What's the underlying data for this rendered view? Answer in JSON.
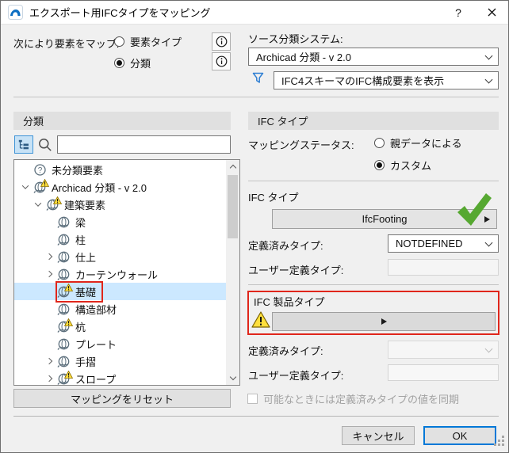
{
  "window": {
    "title": "エクスポート用IFCタイプをマッピング",
    "help_label": "?"
  },
  "header": {
    "map_by_label": "次により要素をマップ:",
    "radio_element_type": "要素タイプ",
    "radio_classification": "分類",
    "source_system_label": "ソース分類システム:",
    "source_system_value": "Archicad 分類 - v 2.0",
    "filter_value": "IFC4スキーマのIFC構成要素を表示"
  },
  "left_panel": {
    "title": "分類",
    "search_value": "",
    "tree": [
      {
        "id": "unclassified",
        "label": "未分類要素",
        "level": 0,
        "expander": "",
        "icon": "question",
        "warning": false,
        "selected": false,
        "outlined": false
      },
      {
        "id": "archicad-classification",
        "label": "Archicad 分類 - v 2.0",
        "level": 0,
        "expander": "expanded",
        "icon": "sphere",
        "warning": true,
        "selected": false,
        "outlined": false
      },
      {
        "id": "building-elements",
        "label": "建築要素",
        "level": 1,
        "expander": "expanded",
        "icon": "sphere",
        "warning": true,
        "selected": false,
        "outlined": false
      },
      {
        "id": "beam",
        "label": "梁",
        "level": 2,
        "expander": "",
        "icon": "sphere",
        "warning": false,
        "selected": false,
        "outlined": false
      },
      {
        "id": "column",
        "label": "柱",
        "level": 2,
        "expander": "",
        "icon": "sphere",
        "warning": false,
        "selected": false,
        "outlined": false
      },
      {
        "id": "finish",
        "label": "仕上",
        "level": 2,
        "expander": "collapsed",
        "icon": "sphere",
        "warning": false,
        "selected": false,
        "outlined": false
      },
      {
        "id": "curtain-wall",
        "label": "カーテンウォール",
        "level": 2,
        "expander": "collapsed",
        "icon": "sphere",
        "warning": false,
        "selected": false,
        "outlined": false
      },
      {
        "id": "foundation",
        "label": "基礎",
        "level": 2,
        "expander": "",
        "icon": "sphere",
        "warning": true,
        "selected": true,
        "outlined": true
      },
      {
        "id": "structural-member",
        "label": "構造部材",
        "level": 2,
        "expander": "",
        "icon": "sphere",
        "warning": false,
        "selected": false,
        "outlined": false
      },
      {
        "id": "pile",
        "label": "杭",
        "level": 2,
        "expander": "",
        "icon": "sphere",
        "warning": true,
        "selected": false,
        "outlined": false
      },
      {
        "id": "plate",
        "label": "プレート",
        "level": 2,
        "expander": "",
        "icon": "sphere",
        "warning": false,
        "selected": false,
        "outlined": false
      },
      {
        "id": "railing",
        "label": "手摺",
        "level": 2,
        "expander": "collapsed",
        "icon": "sphere",
        "warning": false,
        "selected": false,
        "outlined": false
      },
      {
        "id": "slope",
        "label": "スロープ",
        "level": 2,
        "expander": "collapsed",
        "icon": "sphere",
        "warning": true,
        "selected": false,
        "outlined": false
      }
    ],
    "reset_button": "マッピングをリセット"
  },
  "right_panel": {
    "title": "IFC タイプ",
    "mapping_status_label": "マッピングステータス:",
    "radio_parent": "親データによる",
    "radio_custom": "カスタム",
    "ifc_type_label": "IFC タイプ",
    "ifc_type_value": "IfcFooting",
    "predefined_type_label": "定義済みタイプ:",
    "predefined_type_value": "NOTDEFINED",
    "user_defined_type_label": "ユーザー定義タイプ:",
    "user_defined_type_value": "",
    "product_section_label": "IFC 製品タイプ",
    "product_predefined_type_label": "定義済みタイプ:",
    "product_predefined_type_value": "",
    "product_user_defined_type_label": "ユーザー定義タイプ:",
    "product_user_defined_type_value": "",
    "sync_checkbox_label": "可能なときには定義済みタイプの値を同期"
  },
  "footer": {
    "cancel_label": "キャンセル",
    "ok_label": "OK"
  },
  "colors": {
    "accent_blue": "#0078d7",
    "selection_blue": "#cce8ff",
    "error_red": "#e0261b",
    "warning_yellow": "#ffdf3d",
    "success_green": "#56a831",
    "panel_gray": "#e0e0e0"
  },
  "icons": {
    "app": "archicad-logo",
    "help": "question-mark",
    "close": "x-mark",
    "info": "circle-i",
    "filter": "funnel",
    "tree_view": "hierarchy",
    "search": "magnifier",
    "expand": "chevron",
    "warning": "yellow-triangle-exclamation",
    "success": "green-checkmark",
    "flyout": "right-arrow",
    "resize": "grip-dots"
  }
}
